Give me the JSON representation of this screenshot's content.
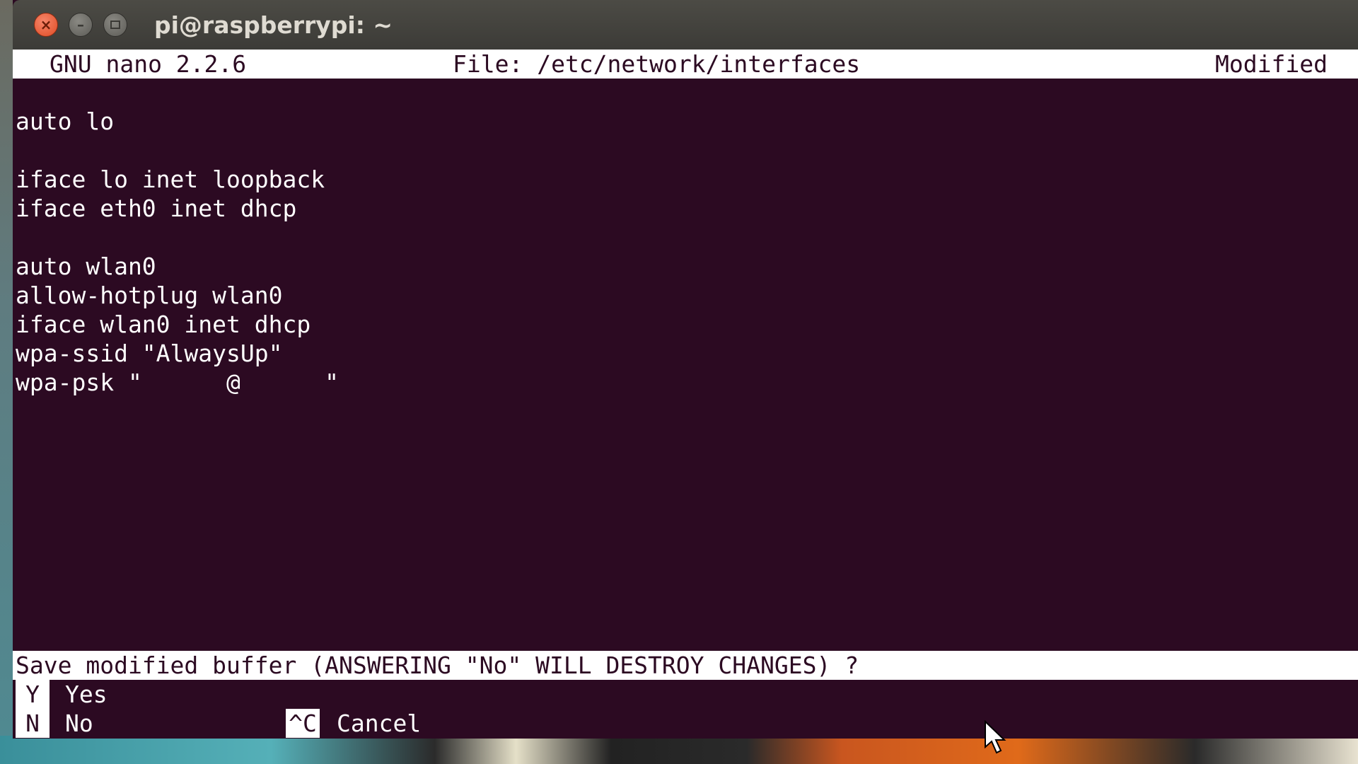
{
  "window": {
    "title": "pi@raspberrypi: ~",
    "close_glyph": "×",
    "minimize_glyph": "–"
  },
  "nano": {
    "version": "GNU nano 2.2.6",
    "file": "File: /etc/network/interfaces",
    "status": "Modified",
    "lines": [
      "auto lo",
      "",
      "iface lo inet loopback",
      "iface eth0 inet dhcp",
      "",
      "auto wlan0",
      "allow-hotplug wlan0",
      "iface wlan0 inet dhcp",
      "wpa-ssid \"AlwaysUp\"",
      "wpa-psk \"      @      \""
    ],
    "prompt": "Save modified buffer (ANSWERING \"No\" WILL DESTROY CHANGES) ?",
    "shortcuts": {
      "yes_key": "Y",
      "yes_label": "Yes",
      "no_key": "N",
      "no_label": "No",
      "cancel_key": "^C",
      "cancel_label": "Cancel"
    }
  },
  "colors": {
    "terminal_bg": "#2c0a22",
    "terminal_fg": "#ffffff",
    "close_button": "#df4b24"
  },
  "icons": [
    "close-icon",
    "minimize-icon",
    "maximize-icon",
    "mouse-pointer-icon"
  ]
}
